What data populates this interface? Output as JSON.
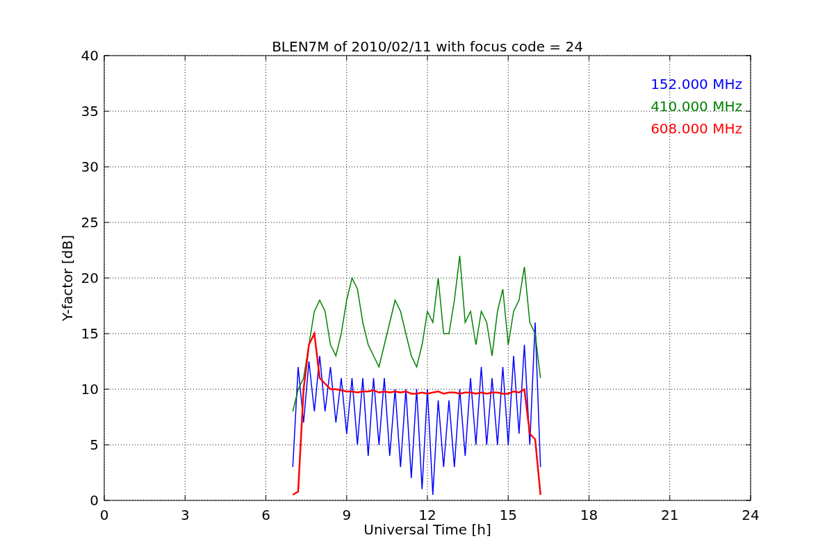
{
  "chart_data": {
    "type": "line",
    "title": "BLEN7M of 2010/02/11 with focus code = 24",
    "xlabel": "Universal Time [h]",
    "ylabel": "Y-factor [dB]",
    "x": [
      7.0,
      7.2,
      7.4,
      7.6,
      7.8,
      8.0,
      8.2,
      8.4,
      8.6,
      8.8,
      9.0,
      9.2,
      9.4,
      9.6,
      9.8,
      10.0,
      10.2,
      10.4,
      10.6,
      10.8,
      11.0,
      11.2,
      11.4,
      11.6,
      11.8,
      12.0,
      12.2,
      12.4,
      12.6,
      12.8,
      13.0,
      13.2,
      13.4,
      13.6,
      13.8,
      14.0,
      14.2,
      14.4,
      14.6,
      14.8,
      15.0,
      15.2,
      15.4,
      15.6,
      15.8,
      16.0,
      16.2
    ],
    "series": [
      {
        "name": "152.000 MHz",
        "color": "#0000ff",
        "values": [
          3,
          12,
          7,
          12.5,
          8,
          13,
          8,
          12,
          7,
          11,
          6,
          11,
          5,
          11,
          4,
          11,
          5,
          11,
          4,
          10,
          3,
          10,
          2,
          10,
          1,
          10,
          0.5,
          9,
          3,
          9,
          3,
          10,
          4,
          11,
          5,
          12,
          5,
          11,
          5,
          12,
          5,
          13,
          6,
          14,
          5,
          16,
          3
        ]
      },
      {
        "name": "410.000 MHz",
        "color": "#008000",
        "values": [
          8,
          10,
          11,
          14,
          17,
          18,
          17,
          14,
          13,
          15,
          18,
          20,
          19,
          16,
          14,
          13,
          12,
          14,
          16,
          18,
          17,
          15,
          13,
          12,
          14,
          17,
          16,
          20,
          15,
          15,
          18,
          22,
          16,
          17,
          14,
          17,
          16,
          13,
          17,
          19,
          14,
          17,
          18,
          21,
          16,
          15,
          11
        ]
      },
      {
        "name": "608.000 MHz",
        "color": "#ff0000",
        "values": [
          0.5,
          0.8,
          10,
          14,
          15,
          11,
          10.5,
          10,
          10,
          9.9,
          9.8,
          9.8,
          9.7,
          9.8,
          9.8,
          9.9,
          9.7,
          9.8,
          9.7,
          9.8,
          9.7,
          9.8,
          9.6,
          9.6,
          9.7,
          9.6,
          9.7,
          9.8,
          9.6,
          9.7,
          9.7,
          9.6,
          9.7,
          9.7,
          9.6,
          9.7,
          9.6,
          9.7,
          9.7,
          9.6,
          9.6,
          9.8,
          9.7,
          10,
          6,
          5.5,
          0.5
        ]
      }
    ],
    "xlim": [
      0,
      24
    ],
    "ylim": [
      0,
      40
    ],
    "xticks": [
      0,
      3,
      6,
      9,
      12,
      15,
      18,
      21,
      24
    ],
    "yticks": [
      0,
      5,
      10,
      15,
      20,
      25,
      30,
      35,
      40
    ],
    "grid": true
  }
}
